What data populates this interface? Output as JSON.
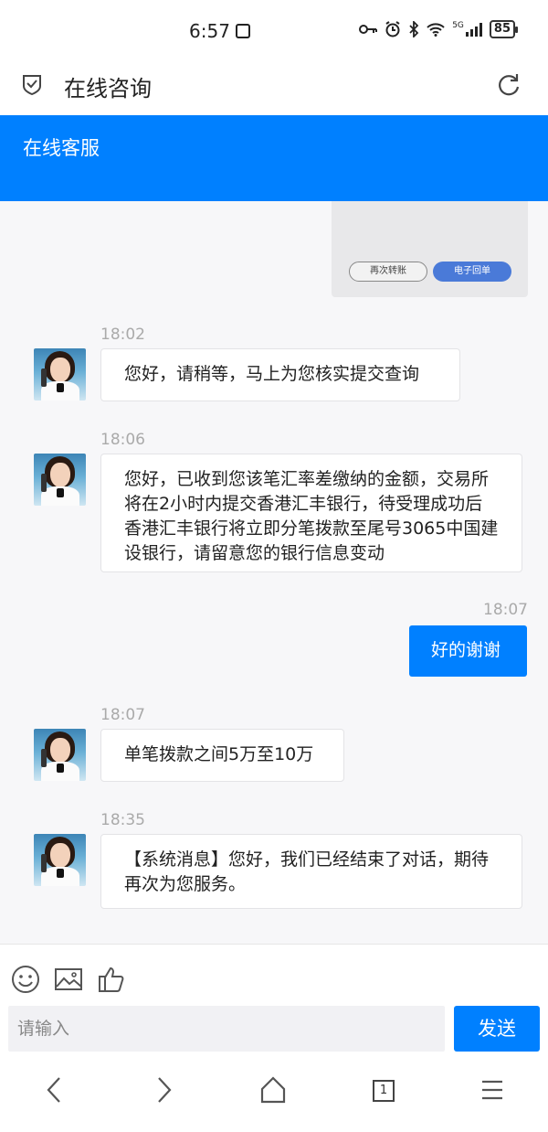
{
  "status_bar": {
    "time": "6:57",
    "network": "5G",
    "battery": "85"
  },
  "header": {
    "title": "在线咨询"
  },
  "banner": {
    "title": "在线客服"
  },
  "receipt_card": {
    "transfer_again_label": "再次转账",
    "e_receipt_label": "电子回单"
  },
  "messages": [
    {
      "time": "18:02",
      "sender": "agent",
      "text": "您好，请稍等，马上为您核实提交查询"
    },
    {
      "time": "18:06",
      "sender": "agent",
      "text": "您好，已收到您该笔汇率差缴纳的金额，交易所将在2小时内提交香港汇丰银行，待受理成功后香港汇丰银行将立即分笔拨款至尾号3065中国建设银行，请留意您的银行信息变动"
    },
    {
      "time": "18:07",
      "sender": "user",
      "text": "好的谢谢"
    },
    {
      "time": "18:07",
      "sender": "agent",
      "text": "单笔拨款之间5万至10万"
    },
    {
      "time": "18:35",
      "sender": "agent",
      "text": "【系统消息】您好，我们已经结束了对话，期待再次为您服务。"
    }
  ],
  "composer": {
    "placeholder": "请输入",
    "send_label": "发送"
  },
  "browser_nav": {
    "tab_count": "1"
  },
  "colors": {
    "accent": "#0080ff",
    "background": "#f7f7f9"
  }
}
